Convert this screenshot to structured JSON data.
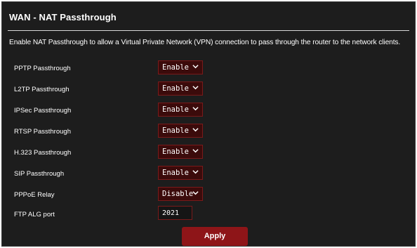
{
  "panel": {
    "title": "WAN - NAT Passthrough",
    "description": "Enable NAT Passthrough to allow a Virtual Private Network (VPN) connection to pass through the router to the network clients."
  },
  "settings": [
    {
      "label": "PPTP Passthrough",
      "value": "Enable"
    },
    {
      "label": "L2TP Passthrough",
      "value": "Enable"
    },
    {
      "label": "IPSec Passthrough",
      "value": "Enable"
    },
    {
      "label": "RTSP Passthrough",
      "value": "Enable"
    },
    {
      "label": "H.323 Passthrough",
      "value": "Enable"
    },
    {
      "label": "SIP Passthrough",
      "value": "Enable"
    },
    {
      "label": "PPPoE Relay",
      "value": "Disable"
    }
  ],
  "ftp_alg": {
    "label": "FTP ALG port",
    "value": "2021"
  },
  "actions": {
    "apply_label": "Apply"
  },
  "icons": {
    "dropdown": "chevron-down-icon"
  },
  "colors": {
    "background": "#1d1d1d",
    "select_fill": "#3b0b0b",
    "accent_border": "#7a1a1a",
    "apply_button": "#8e1518",
    "text": "#ffffff"
  }
}
